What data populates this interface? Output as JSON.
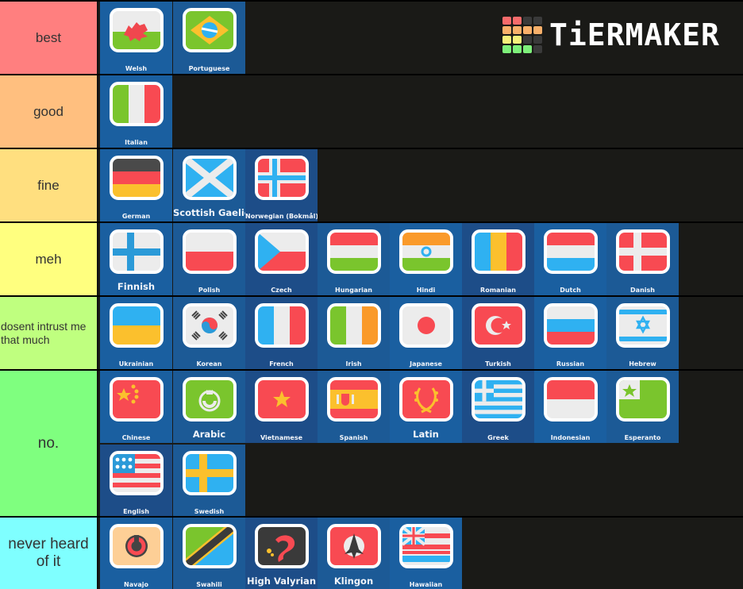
{
  "logo": {
    "text": "TiERMAKER",
    "grid_colors": [
      "#f76b6b",
      "#f76b6b",
      "#3a3a3a",
      "#3a3a3a",
      "#f9b06a",
      "#f9b06a",
      "#f9b06a",
      "#f9b06a",
      "#f6f07a",
      "#f6f07a",
      "#3a3a3a",
      "#3a3a3a",
      "#7ef07a",
      "#7ef07a",
      "#7ef07a",
      "#3a3a3a"
    ]
  },
  "tiers": [
    {
      "label": "best",
      "color": "#ff7f7f",
      "items": [
        {
          "name": "Welsh",
          "flag": "welsh-flag-icon"
        },
        {
          "name": "Portuguese",
          "flag": "brazil-flag-icon"
        }
      ]
    },
    {
      "label": "good",
      "color": "#ffbf7f",
      "items": [
        {
          "name": "Italian",
          "flag": "italy-flag-icon"
        }
      ]
    },
    {
      "label": "fine",
      "color": "#ffdf7f",
      "items": [
        {
          "name": "German",
          "flag": "germany-flag-icon"
        },
        {
          "name": "Scottish Gaelic",
          "flag": "scotland-flag-icon"
        },
        {
          "name": "Norwegian (Bokmål)",
          "flag": "norway-flag-icon"
        }
      ]
    },
    {
      "label": "meh",
      "color": "#ffff7f",
      "items": [
        {
          "name": "Finnish",
          "flag": "finland-flag-icon"
        },
        {
          "name": "Polish",
          "flag": "poland-flag-icon"
        },
        {
          "name": "Czech",
          "flag": "czech-flag-icon"
        },
        {
          "name": "Hungarian",
          "flag": "hungary-flag-icon"
        },
        {
          "name": "Hindi",
          "flag": "india-flag-icon"
        },
        {
          "name": "Romanian",
          "flag": "romania-flag-icon"
        },
        {
          "name": "Dutch",
          "flag": "netherlands-flag-icon"
        },
        {
          "name": "Danish",
          "flag": "denmark-flag-icon"
        }
      ]
    },
    {
      "label": "dosent intrust me that much",
      "color": "#bfff7f",
      "items": [
        {
          "name": "Ukrainian",
          "flag": "ukraine-flag-icon"
        },
        {
          "name": "Korean",
          "flag": "korea-flag-icon"
        },
        {
          "name": "French",
          "flag": "france-flag-icon"
        },
        {
          "name": "Irish",
          "flag": "ireland-flag-icon"
        },
        {
          "name": "Japanese",
          "flag": "japan-flag-icon"
        },
        {
          "name": "Turkish",
          "flag": "turkey-flag-icon"
        },
        {
          "name": "Russian",
          "flag": "russia-flag-icon"
        },
        {
          "name": "Hebrew",
          "flag": "israel-flag-icon"
        }
      ]
    },
    {
      "label": "no.",
      "color": "#7fff7f",
      "items": [
        {
          "name": "Chinese",
          "flag": "china-flag-icon"
        },
        {
          "name": "Arabic",
          "flag": "arabic-flag-icon"
        },
        {
          "name": "Vietnamese",
          "flag": "vietnam-flag-icon"
        },
        {
          "name": "Spanish",
          "flag": "spain-flag-icon"
        },
        {
          "name": "Latin",
          "flag": "latin-flag-icon"
        },
        {
          "name": "Greek",
          "flag": "greece-flag-icon"
        },
        {
          "name": "Indonesian",
          "flag": "indonesia-flag-icon"
        },
        {
          "name": "Esperanto",
          "flag": "esperanto-flag-icon"
        },
        {
          "name": "English",
          "flag": "usa-flag-icon"
        },
        {
          "name": "Swedish",
          "flag": "sweden-flag-icon"
        }
      ]
    },
    {
      "label": "never heard of it",
      "color": "#7fffff",
      "items": [
        {
          "name": "Navajo",
          "flag": "navajo-flag-icon"
        },
        {
          "name": "Swahili",
          "flag": "tanzania-flag-icon"
        },
        {
          "name": "High Valyrian",
          "flag": "valyrian-dragon-flag-icon"
        },
        {
          "name": "Klingon",
          "flag": "klingon-flag-icon"
        },
        {
          "name": "Hawaiian",
          "flag": "hawaii-flag-icon"
        }
      ]
    }
  ]
}
